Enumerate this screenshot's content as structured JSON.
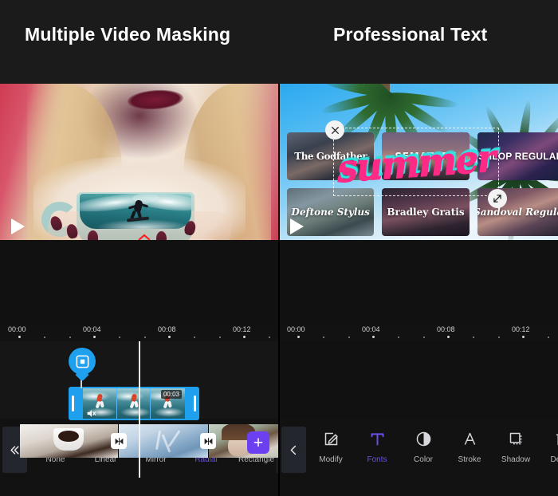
{
  "header": {
    "left_title": "Multiple Video Masking",
    "right_title": "Professional Text"
  },
  "left_pane": {
    "preview": {
      "play_icon": "play-icon",
      "mask_shape": "rectangle",
      "mask_color": "#ff1a1a",
      "chevron_up_icon": "chevron-up-icon",
      "chevron_down_icon": "chevron-down-icon"
    },
    "ruler": {
      "labels": [
        "00:00",
        "00:04",
        "00:08",
        "00:12"
      ]
    },
    "timeline": {
      "selected_clip": {
        "duration_badge": "00:03",
        "mute_icon": "mute-icon",
        "badge_icon": "mask-badge-icon",
        "accent_color": "#1ea0ef"
      },
      "transition_icon": "transition-icon",
      "add_label": "+",
      "add_color": "#6c3ff0"
    },
    "toolbar": {
      "collapse_icon": "double-chevron-left-icon",
      "items": [
        {
          "label": "None",
          "icon": "none-mask-icon",
          "active": false
        },
        {
          "label": "Linear",
          "icon": "linear-mask-icon",
          "active": false
        },
        {
          "label": "Mirror",
          "icon": "mirror-mask-icon",
          "active": false
        },
        {
          "label": "Radial",
          "icon": "radial-mask-icon",
          "active": true
        },
        {
          "label": "Rectangle",
          "icon": "rectangle-mask-icon",
          "active": false
        }
      ],
      "active_color": "#6c4fe8"
    }
  },
  "right_pane": {
    "preview": {
      "play_icon": "play-icon",
      "overlay_text": "summer",
      "text_color_primary": "#ff2a86",
      "text_color_secondary": "#35e0e0",
      "close_icon": "close-icon",
      "resize_icon": "resize-handle-icon"
    },
    "ruler": {
      "labels": [
        "00:00",
        "00:04",
        "00:08",
        "00:12"
      ]
    },
    "font_grid": [
      {
        "name": "The Godfather",
        "style": "f-godfather",
        "bg": "bg1"
      },
      {
        "name": "SEMATARY",
        "style": "f-sematary",
        "bg": "bg2"
      },
      {
        "name": "SHLOP REGULAR",
        "style": "f-shlop",
        "bg": "bg3"
      },
      {
        "name": "Deftone Stylus",
        "style": "f-deftone",
        "bg": "bg4"
      },
      {
        "name": "Bradley Gratis",
        "style": "f-bradley",
        "bg": "bg5"
      },
      {
        "name": "Sandoval Regular",
        "style": "f-sandoval",
        "bg": "bg6"
      }
    ],
    "toolbar": {
      "back_icon": "chevron-left-icon",
      "items": [
        {
          "label": "Modify",
          "icon": "edit-pencil-icon",
          "active": false
        },
        {
          "label": "Fonts",
          "icon": "text-t-icon",
          "active": true
        },
        {
          "label": "Color",
          "icon": "color-contrast-icon",
          "active": false
        },
        {
          "label": "Stroke",
          "icon": "stroke-a-icon",
          "active": false
        },
        {
          "label": "Shadow",
          "icon": "shadow-square-icon",
          "active": false
        },
        {
          "label": "Delete",
          "icon": "trash-icon",
          "active": false
        }
      ],
      "active_color": "#6c4fe8"
    }
  }
}
